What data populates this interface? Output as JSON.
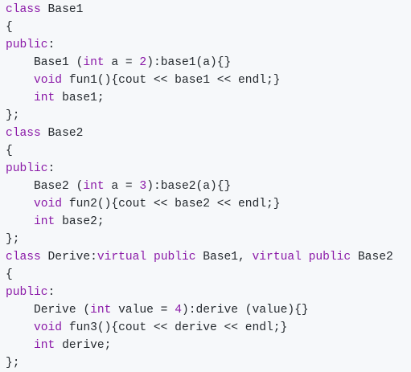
{
  "colors": {
    "background": "#f6f8fa",
    "text": "#24292e",
    "keyword": "#8b1aa8",
    "number": "#8b1aa8"
  },
  "code": {
    "lines": [
      [
        {
          "t": "kw",
          "v": "class"
        },
        {
          "t": "plain",
          "v": " Base1"
        }
      ],
      [
        {
          "t": "plain",
          "v": "{"
        }
      ],
      [
        {
          "t": "kw",
          "v": "public"
        },
        {
          "t": "plain",
          "v": ":"
        }
      ],
      [
        {
          "t": "plain",
          "v": "    Base1 ("
        },
        {
          "t": "kw",
          "v": "int"
        },
        {
          "t": "plain",
          "v": " a = "
        },
        {
          "t": "num",
          "v": "2"
        },
        {
          "t": "plain",
          "v": "):base1(a){}"
        }
      ],
      [
        {
          "t": "plain",
          "v": "    "
        },
        {
          "t": "kw",
          "v": "void"
        },
        {
          "t": "plain",
          "v": " fun1(){cout << base1 << endl;}"
        }
      ],
      [
        {
          "t": "plain",
          "v": "    "
        },
        {
          "t": "kw",
          "v": "int"
        },
        {
          "t": "plain",
          "v": " base1;"
        }
      ],
      [
        {
          "t": "plain",
          "v": "};"
        }
      ],
      [
        {
          "t": "kw",
          "v": "class"
        },
        {
          "t": "plain",
          "v": " Base2"
        }
      ],
      [
        {
          "t": "plain",
          "v": "{"
        }
      ],
      [
        {
          "t": "kw",
          "v": "public"
        },
        {
          "t": "plain",
          "v": ":"
        }
      ],
      [
        {
          "t": "plain",
          "v": "    Base2 ("
        },
        {
          "t": "kw",
          "v": "int"
        },
        {
          "t": "plain",
          "v": " a = "
        },
        {
          "t": "num",
          "v": "3"
        },
        {
          "t": "plain",
          "v": "):base2(a){}"
        }
      ],
      [
        {
          "t": "plain",
          "v": "    "
        },
        {
          "t": "kw",
          "v": "void"
        },
        {
          "t": "plain",
          "v": " fun2(){cout << base2 << endl;}"
        }
      ],
      [
        {
          "t": "plain",
          "v": "    "
        },
        {
          "t": "kw",
          "v": "int"
        },
        {
          "t": "plain",
          "v": " base2;"
        }
      ],
      [
        {
          "t": "plain",
          "v": "};"
        }
      ],
      [
        {
          "t": "kw",
          "v": "class"
        },
        {
          "t": "plain",
          "v": " Derive:"
        },
        {
          "t": "kw",
          "v": "virtual"
        },
        {
          "t": "plain",
          "v": " "
        },
        {
          "t": "kw",
          "v": "public"
        },
        {
          "t": "plain",
          "v": " Base1, "
        },
        {
          "t": "kw",
          "v": "virtual"
        },
        {
          "t": "plain",
          "v": " "
        },
        {
          "t": "kw",
          "v": "public"
        },
        {
          "t": "plain",
          "v": " Base2"
        }
      ],
      [
        {
          "t": "plain",
          "v": "{"
        }
      ],
      [
        {
          "t": "kw",
          "v": "public"
        },
        {
          "t": "plain",
          "v": ":"
        }
      ],
      [
        {
          "t": "plain",
          "v": "    Derive ("
        },
        {
          "t": "kw",
          "v": "int"
        },
        {
          "t": "plain",
          "v": " value = "
        },
        {
          "t": "num",
          "v": "4"
        },
        {
          "t": "plain",
          "v": "):derive (value){}"
        }
      ],
      [
        {
          "t": "plain",
          "v": "    "
        },
        {
          "t": "kw",
          "v": "void"
        },
        {
          "t": "plain",
          "v": " fun3(){cout << derive << endl;}"
        }
      ],
      [
        {
          "t": "plain",
          "v": "    "
        },
        {
          "t": "kw",
          "v": "int"
        },
        {
          "t": "plain",
          "v": " derive;"
        }
      ],
      [
        {
          "t": "plain",
          "v": "};"
        }
      ]
    ]
  }
}
